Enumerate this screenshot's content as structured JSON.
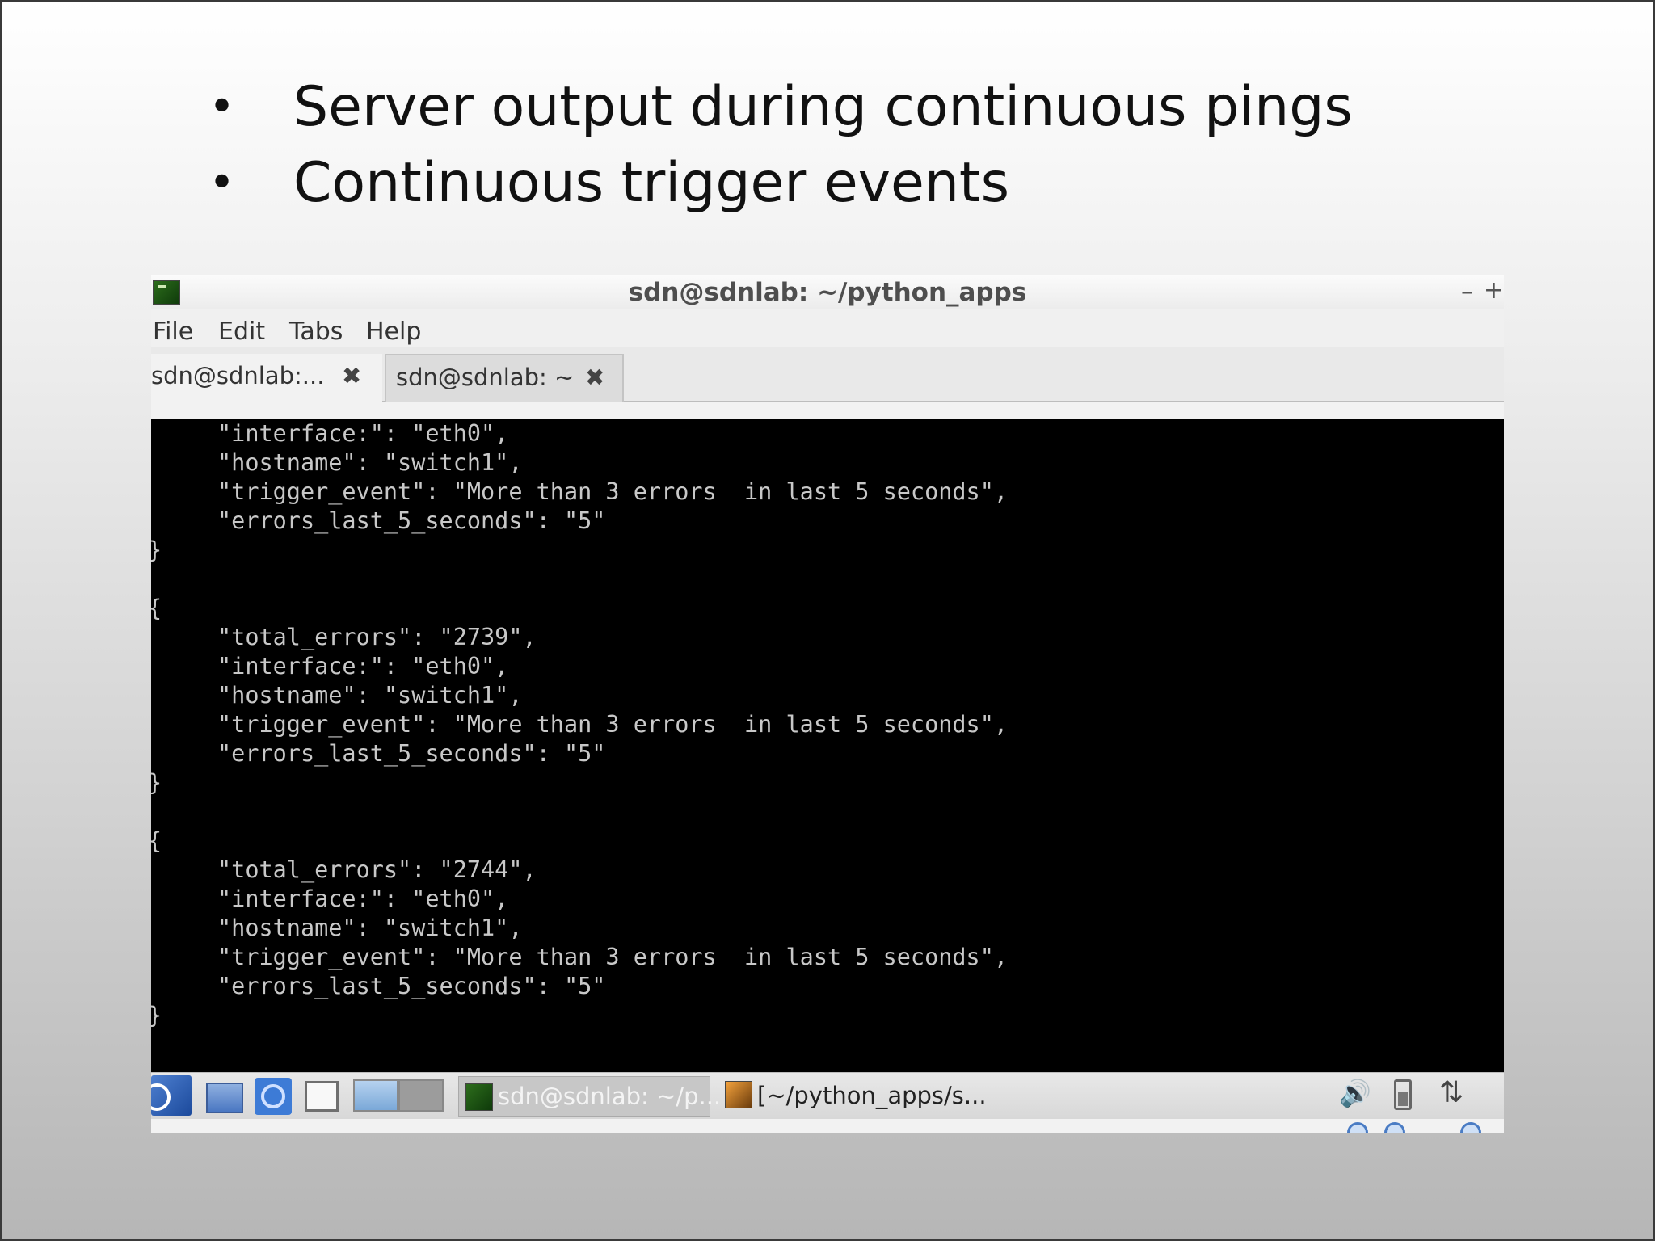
{
  "slide": {
    "bullets": [
      "Server output during continuous pings",
      "Continuous trigger events"
    ],
    "bullet_glyph": "•"
  },
  "window": {
    "title": "sdn@sdnlab: ~/python_apps",
    "minimize_glyph": "–",
    "maximize_glyph": "+",
    "menu": [
      "File",
      "Edit",
      "Tabs",
      "Help"
    ],
    "tabs": [
      {
        "label": "sdn@sdnlab:...",
        "close": "✖"
      },
      {
        "label": "sdn@sdnlab: ~",
        "close": "✖"
      }
    ]
  },
  "terminal": {
    "lines": [
      "\"interface:\": \"eth0\",",
      "\"hostname\": \"switch1\",",
      "\"trigger_event\": \"More than 3 errors  in last 5 seconds\",",
      "\"errors_last_5_seconds\": \"5\"",
      "}",
      "{",
      "\"total_errors\": \"2739\",",
      "\"interface:\": \"eth0\",",
      "\"hostname\": \"switch1\",",
      "\"trigger_event\": \"More than 3 errors  in last 5 seconds\",",
      "\"errors_last_5_seconds\": \"5\"",
      "}",
      "{",
      "\"total_errors\": \"2744\",",
      "\"interface:\": \"eth0\",",
      "\"hostname\": \"switch1\",",
      "\"trigger_event\": \"More than 3 errors  in last 5 seconds\",",
      "\"errors_last_5_seconds\": \"5\"",
      "}"
    ]
  },
  "taskbar": {
    "tasks": [
      {
        "label": "sdn@sdnlab: ~/p..."
      },
      {
        "label": "[~/python_apps/s..."
      }
    ],
    "volume_glyph": "🔊",
    "network_glyph": "⇅",
    "icons": {
      "start": "start-menu-icon",
      "file_manager": "file-manager-icon",
      "browser": "browser-icon",
      "windows": "show-windows-icon",
      "terminal_task": "terminal-icon",
      "editor_task": "text-editor-icon",
      "volume": "volume-icon",
      "battery": "battery-icon",
      "network": "network-icon"
    }
  }
}
